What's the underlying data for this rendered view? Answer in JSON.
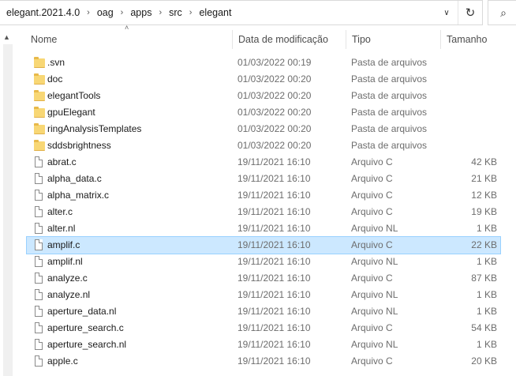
{
  "breadcrumbs": [
    "elegant.2021.4.0",
    "oag",
    "apps",
    "src",
    "elegant"
  ],
  "columns": {
    "name": "Nome",
    "date": "Data de modificação",
    "type": "Tipo",
    "size": "Tamanho"
  },
  "rows": [
    {
      "name": ".svn",
      "date": "01/03/2022 00:19",
      "type": "Pasta de arquivos",
      "size": "",
      "kind": "folder"
    },
    {
      "name": "doc",
      "date": "01/03/2022 00:20",
      "type": "Pasta de arquivos",
      "size": "",
      "kind": "folder"
    },
    {
      "name": "elegantTools",
      "date": "01/03/2022 00:20",
      "type": "Pasta de arquivos",
      "size": "",
      "kind": "folder"
    },
    {
      "name": "gpuElegant",
      "date": "01/03/2022 00:20",
      "type": "Pasta de arquivos",
      "size": "",
      "kind": "folder"
    },
    {
      "name": "ringAnalysisTemplates",
      "date": "01/03/2022 00:20",
      "type": "Pasta de arquivos",
      "size": "",
      "kind": "folder"
    },
    {
      "name": "sddsbrightness",
      "date": "01/03/2022 00:20",
      "type": "Pasta de arquivos",
      "size": "",
      "kind": "folder"
    },
    {
      "name": "abrat.c",
      "date": "19/11/2021 16:10",
      "type": "Arquivo C",
      "size": "42 KB",
      "kind": "file"
    },
    {
      "name": "alpha_data.c",
      "date": "19/11/2021 16:10",
      "type": "Arquivo C",
      "size": "21 KB",
      "kind": "file"
    },
    {
      "name": "alpha_matrix.c",
      "date": "19/11/2021 16:10",
      "type": "Arquivo C",
      "size": "12 KB",
      "kind": "file"
    },
    {
      "name": "alter.c",
      "date": "19/11/2021 16:10",
      "type": "Arquivo C",
      "size": "19 KB",
      "kind": "file"
    },
    {
      "name": "alter.nl",
      "date": "19/11/2021 16:10",
      "type": "Arquivo NL",
      "size": "1 KB",
      "kind": "file"
    },
    {
      "name": "amplif.c",
      "date": "19/11/2021 16:10",
      "type": "Arquivo C",
      "size": "22 KB",
      "kind": "file",
      "selected": true
    },
    {
      "name": "amplif.nl",
      "date": "19/11/2021 16:10",
      "type": "Arquivo NL",
      "size": "1 KB",
      "kind": "file"
    },
    {
      "name": "analyze.c",
      "date": "19/11/2021 16:10",
      "type": "Arquivo C",
      "size": "87 KB",
      "kind": "file"
    },
    {
      "name": "analyze.nl",
      "date": "19/11/2021 16:10",
      "type": "Arquivo NL",
      "size": "1 KB",
      "kind": "file"
    },
    {
      "name": "aperture_data.nl",
      "date": "19/11/2021 16:10",
      "type": "Arquivo NL",
      "size": "1 KB",
      "kind": "file"
    },
    {
      "name": "aperture_search.c",
      "date": "19/11/2021 16:10",
      "type": "Arquivo C",
      "size": "54 KB",
      "kind": "file"
    },
    {
      "name": "aperture_search.nl",
      "date": "19/11/2021 16:10",
      "type": "Arquivo NL",
      "size": "1 KB",
      "kind": "file"
    },
    {
      "name": "apple.c",
      "date": "19/11/2021 16:10",
      "type": "Arquivo C",
      "size": "20 KB",
      "kind": "file"
    }
  ],
  "icons": {
    "separator": "chevron-right-icon",
    "dropdown": "chevron-down-icon",
    "refresh": "refresh-icon",
    "search": "search-icon",
    "sort": "sort-ascending-icon"
  },
  "colors": {
    "selection_bg": "#cce8ff",
    "selection_border": "#99d1ff",
    "folder": "#f8d775"
  }
}
